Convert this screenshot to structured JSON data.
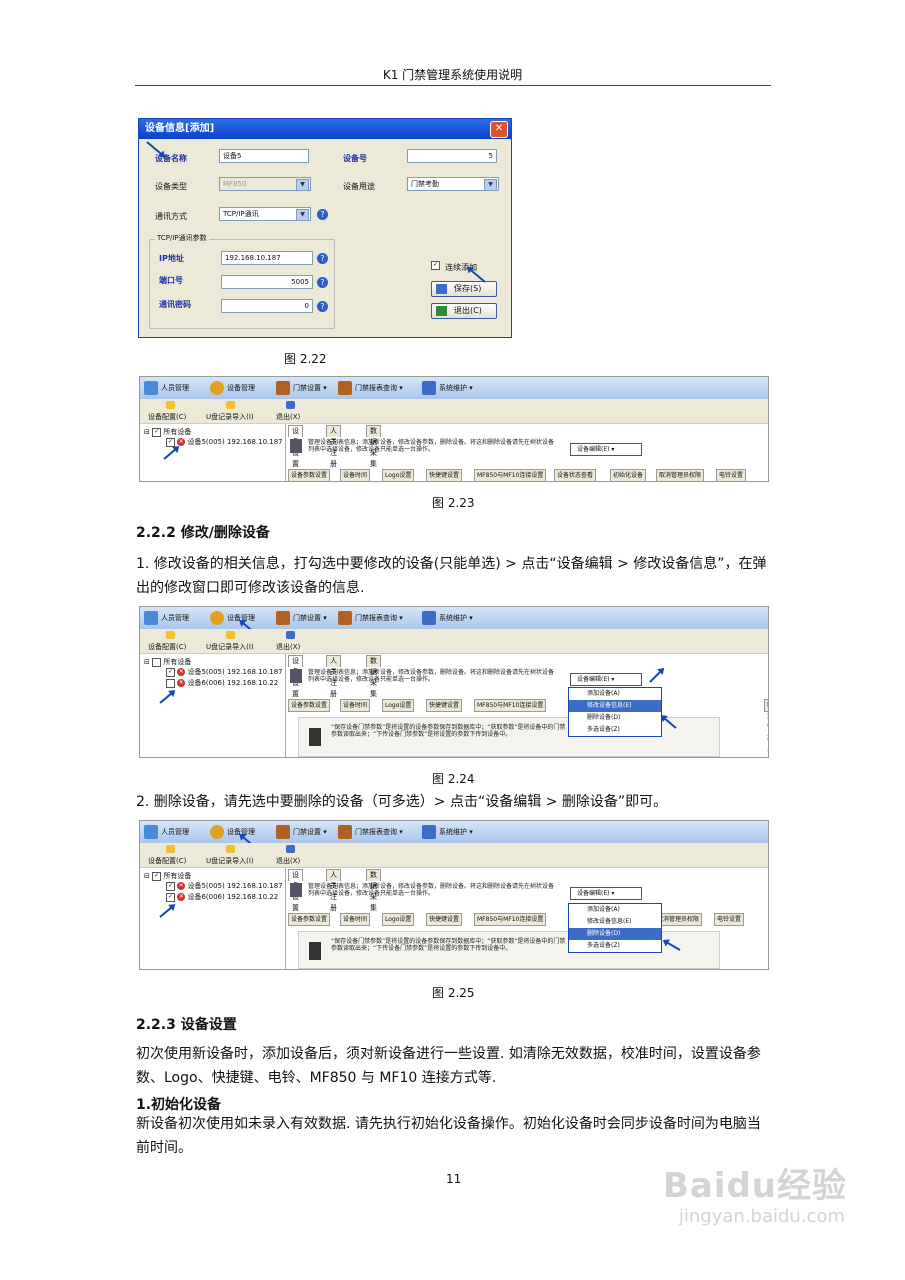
{
  "header": {
    "title": "K1 门禁管理系统使用说明"
  },
  "fig22": {
    "dialog_title": "设备信息[添加]",
    "close": "✕",
    "device_name_label": "设备名称",
    "device_name_value": "设备5",
    "device_no_label": "设备号",
    "device_no_value": "5",
    "device_type_label": "设备类型",
    "device_type_value": "MF850",
    "device_use_label": "设备用途",
    "device_use_value": "门禁考勤",
    "comm_mode_label": "通讯方式",
    "comm_mode_value": "TCP/IP通讯",
    "group_title": "TCP/IP通讯参数",
    "ip_label": "IP地址",
    "ip_value": "192.168.10.187",
    "port_label": "端口号",
    "port_value": "5005",
    "pwd_label": "通讯密码",
    "pwd_value": "0",
    "continuous_label": "连续添加",
    "save_label": "保存(S)",
    "exit_label": "退出(C)",
    "caption": "图 2.22"
  },
  "app": {
    "top_menu": [
      "人员管理",
      "设备管理",
      "门禁设置",
      "门禁报表查询",
      "系统维护"
    ],
    "toolbar": [
      "设备配置(C)",
      "U盘记录导入(I)",
      "退出(X)"
    ],
    "tree_root": "所有设备",
    "device5": "设备5(005) 192.168.10.187",
    "device6": "设备6(006) 192.168.10.22",
    "tabs": [
      "设备设置",
      "人员注册",
      "数据采集"
    ],
    "info_text": "管理设备列表信息；添加新设备，修改设备参数，删除设备。将这和删除设备请先在树状设备列表中选择设备，修改设备只能单选一台操作。",
    "combo_label": "设备编辑(E)",
    "subtabs": [
      "设备参数设置",
      "设备时间",
      "Logo设置",
      "快捷键设置",
      "MF850与MF10连接设置",
      "设备状态查看",
      "初始化设备",
      "取消管理员权限",
      "电铃设置"
    ],
    "menu": [
      "添加设备(A)",
      "修改设备信息(E)",
      "删除设备(D)",
      "多选设备(Z)"
    ],
    "param_text": "“保存设备门禁参数”是将设置的设备参数保存到数据库中；“获取参数”是将设备中的门禁参数读取出来；“下传设备门禁参数”是将设置的参数下传到设备中。"
  },
  "fig23": {
    "caption": "图 2.23"
  },
  "section_222": {
    "title": "2.2.2 修改/删除设备",
    "para1": "1. 修改设备的相关信息，打勾选中要修改的设备(只能单选) > 点击“设备编辑 > 修改设备信息”，在弹出的修改窗口即可修改该设备的信息.",
    "caption24": "图 2.24",
    "para2": "2. 删除设备，请先选中要删除的设备（可多选）> 点击“设备编辑 > 删除设备”即可。",
    "caption25": "图 2.25"
  },
  "section_223": {
    "title": "2.2.3 设备设置",
    "para": "初次使用新设备时，添加设备后，须对新设备进行一些设置. 如清除无效数据，校准时间，设置设备参数、Logo、快捷键、电铃、MF850 与 MF10 连接方式等.",
    "sub_title": "1.初始化设备",
    "sub_para": "新设备初次使用如未录入有效数据. 请先执行初始化设备操作。初始化设备时会同步设备时间为电脑当前时间。"
  },
  "page_number": "11",
  "watermark": {
    "logo": "Baidu经验",
    "url": "jingyan.baidu.com"
  },
  "colors": {
    "titlebar": "#0a40c8",
    "highlight": "#3a6cc8",
    "window_bg": "#ece9d8"
  }
}
